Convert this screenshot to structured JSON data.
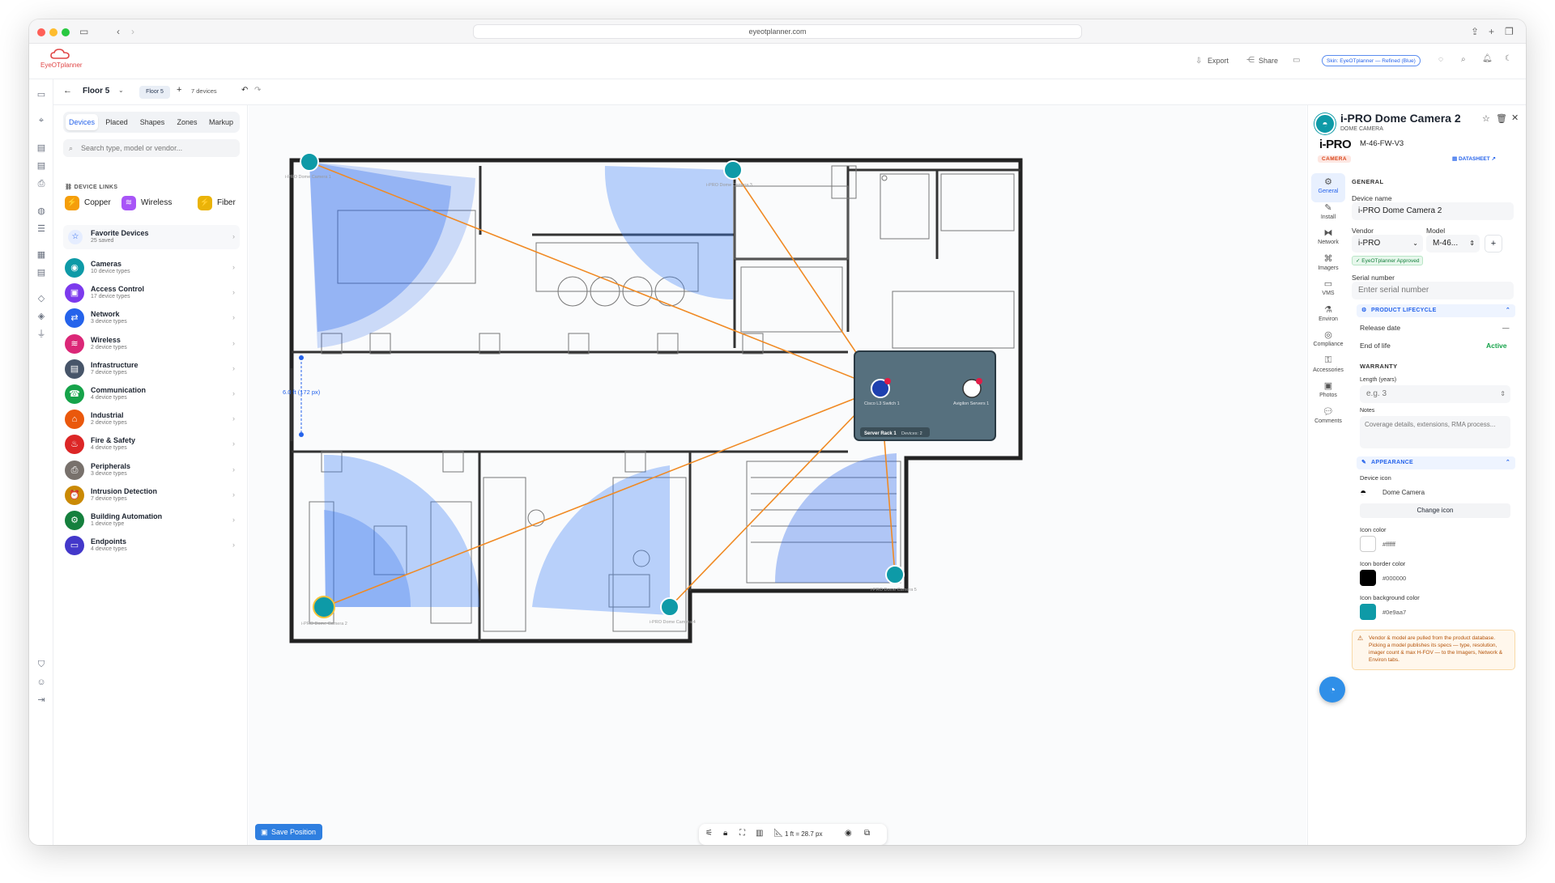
{
  "browser": {
    "url": "eyeotplanner.com"
  },
  "app": {
    "logo_text": "EyeOTplanner",
    "export": "Export",
    "share": "Share",
    "skin_badge": "Skin: EyeOTplanner — Refined (Blue)"
  },
  "floor": {
    "title": "Floor 5",
    "chip": "Floor 5",
    "device_count": "7 devices"
  },
  "sidebar": {
    "tabs": [
      "Devices",
      "Placed",
      "Shapes",
      "Zones",
      "Markup"
    ],
    "search_placeholder": "Search type, model or vendor...",
    "device_links_title": "DEVICE LINKS",
    "links": [
      {
        "label": "Copper",
        "color": "#f59e0b"
      },
      {
        "label": "Wireless",
        "color": "#a855f7"
      },
      {
        "label": "Fiber",
        "color": "#eab308"
      }
    ],
    "favorites": {
      "title": "Favorite Devices",
      "sub": "25 saved"
    },
    "categories": [
      {
        "name": "Cameras",
        "sub": "10 device types",
        "color": "#0e9aa7",
        "icon": "camera-icon"
      },
      {
        "name": "Access Control",
        "sub": "17 device types",
        "color": "#7c3aed",
        "icon": "door-icon"
      },
      {
        "name": "Network",
        "sub": "3 device types",
        "color": "#2563eb",
        "icon": "network-icon"
      },
      {
        "name": "Wireless",
        "sub": "2 device types",
        "color": "#db2777",
        "icon": "wifi-icon"
      },
      {
        "name": "Infrastructure",
        "sub": "7 device types",
        "color": "#475569",
        "icon": "building-icon"
      },
      {
        "name": "Communication",
        "sub": "4 device types",
        "color": "#16a34a",
        "icon": "phone-icon"
      },
      {
        "name": "Industrial",
        "sub": "2 device types",
        "color": "#ea580c",
        "icon": "factory-icon"
      },
      {
        "name": "Fire & Safety",
        "sub": "4 device types",
        "color": "#dc2626",
        "icon": "fire-icon"
      },
      {
        "name": "Peripherals",
        "sub": "3 device types",
        "color": "#78716c",
        "icon": "printer-icon"
      },
      {
        "name": "Intrusion Detection",
        "sub": "7 device types",
        "color": "#ca8a04",
        "icon": "alarm-icon"
      },
      {
        "name": "Building Automation",
        "sub": "1 device type",
        "color": "#15803d",
        "icon": "automation-icon"
      },
      {
        "name": "Endpoints",
        "sub": "4 device types",
        "color": "#4338ca",
        "icon": "monitor-icon"
      }
    ]
  },
  "canvas": {
    "measure_label": "6.0 ft (172 px)",
    "rack": {
      "title": "Server Rack 1",
      "devices": "Devices: 2",
      "switch_label": "Cisco L3 Switch 1",
      "server_label": "Avigilon Servers 1"
    },
    "camera_labels": [
      "i-PRO Dome Camera 1",
      "i-PRO Dome Camera 3",
      "i-PRO Dome Camera 2",
      "i-PRO Dome Camera 4",
      "i-PRO Dome Camera 5"
    ],
    "save_position": "Save Position",
    "scale": "1 ft = 28.7 px"
  },
  "panel": {
    "title": "i-PRO Dome Camera 2",
    "subtitle": "DOME CAMERA",
    "vendor_logo": "i-PRO",
    "model_code": "M-46-FW-V3",
    "badge": "CAMERA",
    "datasheet": "DATASHEET",
    "vtabs": [
      "General",
      "Install",
      "Network",
      "Imagers",
      "VMS",
      "Environ",
      "Compliance",
      "Accessories",
      "Photos",
      "Comments"
    ],
    "section_general": "GENERAL",
    "device_name_label": "Device name",
    "device_name_value": "i-PRO Dome Camera 2",
    "vendor_label": "Vendor",
    "vendor_value": "i-PRO",
    "model_label": "Model",
    "model_value": "M-46...",
    "approved": "EyeOTplanner Approved",
    "serial_label": "Serial number",
    "serial_placeholder": "Enter serial number",
    "lifecycle_title": "PRODUCT LIFECYCLE",
    "release_label": "Release date",
    "release_value": "—",
    "eol_label": "End of life",
    "eol_value": "Active",
    "warranty_title": "WARRANTY",
    "length_label": "Length (years)",
    "length_placeholder": "e.g. 3",
    "notes_label": "Notes",
    "notes_placeholder": "Coverage details, extensions, RMA process...",
    "appearance_title": "APPEARANCE",
    "device_icon_label": "Device icon",
    "device_icon_value": "Dome Camera",
    "change_icon": "Change icon",
    "icon_color_label": "Icon color",
    "icon_color_value": "#ffffff",
    "icon_border_label": "Icon border color",
    "icon_border_value": "#000000",
    "icon_bg_label": "Icon background color",
    "icon_bg_value": "#0e9aa7",
    "note": "Vendor & model are pulled from the product database. Picking a model publishes its specs — type, resolution, imager count & max H-FOV — to the Imagers, Network & Environ tabs."
  }
}
